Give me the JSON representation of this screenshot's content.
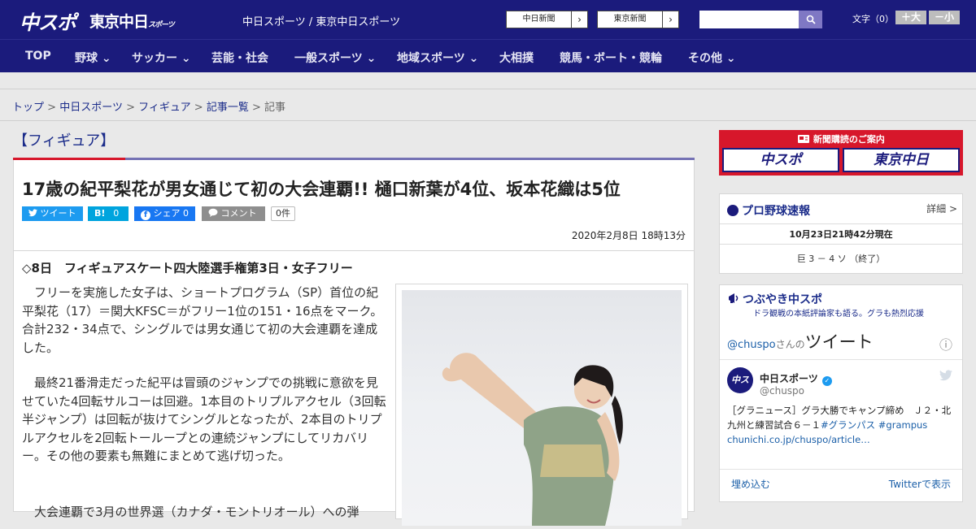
{
  "header": {
    "logo_primary": "中スポ",
    "logo_secondary": "東京中日",
    "logo_secondary_sub": "スポーツ",
    "site_name": "中日スポーツ / 東京中日スポーツ",
    "links": [
      {
        "label": "中日新聞",
        "arrow": "›"
      },
      {
        "label": "東京新聞",
        "arrow": "›"
      }
    ],
    "search": {
      "placeholder": "",
      "icon": "search-icon"
    },
    "font_size": {
      "label": "文字（0）",
      "larger": "＋大",
      "smaller": "－小"
    }
  },
  "nav": {
    "items": [
      {
        "label": "TOP"
      },
      {
        "label": "野球 ⌄"
      },
      {
        "label": "サッカー ⌄"
      },
      {
        "label": "芸能・社会"
      },
      {
        "label": "一般スポーツ ⌄"
      },
      {
        "label": "地域スポーツ ⌄"
      },
      {
        "label": "大相撲"
      },
      {
        "label": "競馬・ボート・競輪"
      },
      {
        "label": "その他 ⌄"
      }
    ]
  },
  "breadcrumb": {
    "items": [
      "トップ",
      "中日スポーツ",
      "フィギュア",
      "記事一覧"
    ],
    "separator": ">",
    "current": "記事"
  },
  "article": {
    "category": "【フィギュア】",
    "headline": "17歳の紀平梨花が男女通じて初の大会連覇!! 樋口新葉が4位、坂本花織は5位",
    "share": {
      "tweet": "ツイート",
      "hatena_label": "B!",
      "hatena_count": "0",
      "facebook_label": "シェア",
      "facebook_count": "0",
      "comment": "コメント",
      "count_badge": "0件"
    },
    "date": "2020年2月8日 18時13分",
    "subheading": "◇8日　フィギュアスケート四大陸選手権第3日・女子フリー",
    "paragraphs": [
      "フリーを実施した女子は、ショートプログラム（SP）首位の紀平梨花（17）＝関大KFSC＝がフリー1位の151・16点をマーク。合計232・34点で、シングルでは男女通じて初の大会連覇を達成した。",
      "最終21番滑走だった紀平は冒頭のジャンプでの挑戦に意欲を見せていた4回転サルコーは回避。1本目のトリプルアクセル（3回転半ジャンプ）は回転が抜けてシングルとなったが、2本目のトリプルアクセルを2回転トーループとの連続ジャンプにしてリカバリー。その他の要素も無難にまとめて逃げ切った。",
      "大会連覇で3月の世界選（カナダ・モントリオール）への弾"
    ]
  },
  "sidebar": {
    "subscribe": {
      "title": "新聞購読のご案内",
      "options": [
        "中スポ",
        "東京中日"
      ]
    },
    "baseball": {
      "title": "プロ野球速報",
      "detail_link": "詳細 >",
      "as_of": "10月23日21時42分現在",
      "score": "巨 3 － 4 ソ （終了）"
    },
    "tweets": {
      "title": "つぶやき中スポ",
      "subtitle": "ドラ観戦の本紙評論家も語る。グラも熱烈応援",
      "header_handle": "@chuspo",
      "header_suffix": "さんの",
      "header_word": "ツイート",
      "info_icon": "ⓘ",
      "account_name": "中日スポーツ",
      "account_handle": "@chuspo",
      "tweet_text": "［グラニュース］グラ大勝でキャンプ締め　Ｊ２・北九州と練習試合６－１",
      "hashtags": [
        "#グランパス",
        "#grampus"
      ],
      "link": "chunichi.co.jp/chuspo/article…",
      "embed": "埋め込む",
      "view_on": "Twitterで表示"
    }
  },
  "colors": {
    "brand_navy": "#1b1b7c",
    "accent_red": "#d7172b",
    "link": "#1b2c8a",
    "purple_rule": "#7572b4"
  }
}
